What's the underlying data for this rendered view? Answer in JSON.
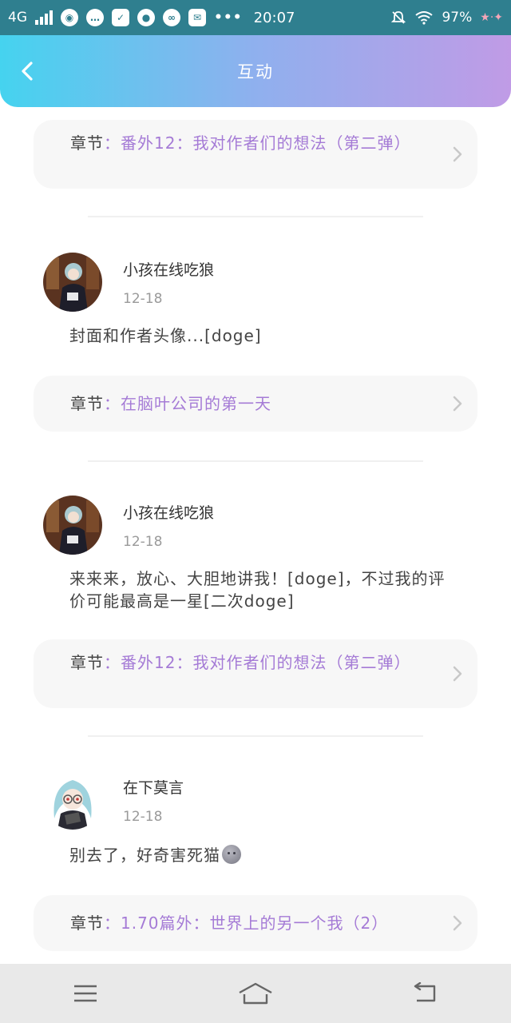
{
  "status_bar": {
    "network": "4G",
    "time": "20:07",
    "more": "•••",
    "battery": "97%",
    "app_icons": [
      "browser-icon",
      "chat-bubble-icon",
      "shield-icon",
      "palette-icon",
      "wechat-icon",
      "mail-icon"
    ]
  },
  "header": {
    "title": "互动",
    "back_icon": "chevron-left-icon"
  },
  "colors": {
    "accent": "#a57bd6",
    "header_gradient_start": "#45d3ef",
    "header_gradient_end": "#c09be6",
    "status_bar": "#2f7f8f"
  },
  "items": [
    {
      "chapter_label": "章节",
      "chapter_colon": "：",
      "chapter_title": "番外12：我对作者们的想法（第二弹）"
    },
    {
      "username": "小孩在线吃狼",
      "date": "12-18",
      "comment": "封面和作者头像...[doge]",
      "chapter_label": "章节",
      "chapter_colon": "：",
      "chapter_title": "在脑叶公司的第一天"
    },
    {
      "username": "小孩在线吃狼",
      "date": "12-18",
      "comment": "来来来，放心、大胆地讲我！[doge]，不过我的评价可能最高是一星[二次doge]",
      "chapter_label": "章节",
      "chapter_colon": "：",
      "chapter_title": "番外12：我对作者们的想法（第二弹）"
    },
    {
      "username": "在下莫言",
      "date": "12-18",
      "comment": "别去了，好奇害死猫",
      "comment_emoji": "grey-blob-emoji",
      "chapter_label": "章节",
      "chapter_colon": "：",
      "chapter_title": "1.70篇外：世界上的另一个我（2）"
    }
  ],
  "nav_bar": {
    "menu_icon": "menu-icon",
    "home_icon": "home-icon",
    "back_icon": "back-arrow-icon"
  }
}
